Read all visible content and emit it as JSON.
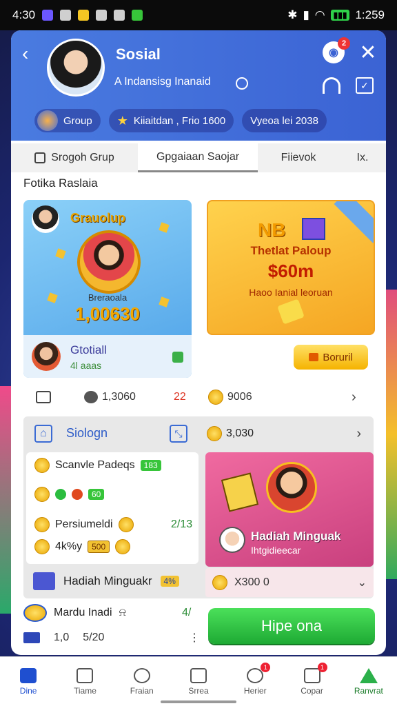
{
  "status_bar": {
    "time": "4:30",
    "right_time": "1:259"
  },
  "header": {
    "title": "Sosial",
    "subtitle": "A Indansisg Inanaid",
    "notif_count": "2",
    "pills": [
      {
        "label": "Group"
      },
      {
        "label": "Kiiaitdan , Frio 1600"
      },
      {
        "label": "Vyeoa lei 2038"
      }
    ]
  },
  "tabs": [
    {
      "label": "Srogoh Grup"
    },
    {
      "label": "Gpgaiaan Saojar"
    },
    {
      "label": "Fiievok"
    },
    {
      "label": "Ix."
    }
  ],
  "section_title": "Fotika Raslaia",
  "promo_blue": {
    "name": "Grauolup",
    "caption": "Breraoala",
    "amount": "1,00630",
    "footer_name": "Gtotiall",
    "footer_sub": "4l aaas"
  },
  "promo_yellow": {
    "logo": "NB",
    "line1": "Thetlat Paloup",
    "line2": "$60m",
    "line3": "Haoo Ianial leoruan",
    "button_label": "Boruril"
  },
  "stats_row": {
    "count": "1,3060",
    "red_value": "22",
    "coins": "9006"
  },
  "group_panel": {
    "title": "Siologn",
    "coins": "3,030",
    "items": [
      {
        "label": "Scanvle Padeqs",
        "badge": "183"
      },
      {
        "badge": "60"
      },
      {
        "label": "Persiumeldi",
        "value": "2/13"
      },
      {
        "label": "4k%y",
        "badge": "500"
      }
    ],
    "footer_label": "Hadiah Minguakr",
    "footer_pct": "4%"
  },
  "promo_pink": {
    "title": "Hadiah Minguak",
    "subtitle": "Ihtgidieecar",
    "bar_value": "X300 0"
  },
  "bottom_row": {
    "label": "Mardu Inadi",
    "value": "4/",
    "sub1": "1,0",
    "sub2": "5/20"
  },
  "cta": {
    "label": "Hipe ona"
  },
  "nav": [
    {
      "label": "Dine",
      "badge": ""
    },
    {
      "label": "Tiame",
      "badge": ""
    },
    {
      "label": "Fraian",
      "badge": ""
    },
    {
      "label": "Srrea",
      "badge": ""
    },
    {
      "label": "Herier",
      "badge": "1"
    },
    {
      "label": "Copar",
      "badge": "1"
    },
    {
      "label": "Ranvrat",
      "badge": ""
    }
  ]
}
